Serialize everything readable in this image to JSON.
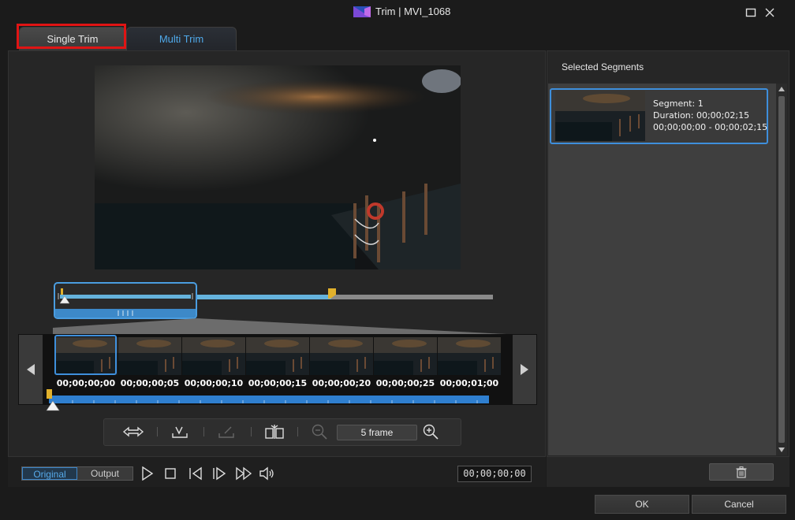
{
  "window": {
    "title": "Trim | MVI_1068",
    "maximize_icon": "maximize-icon",
    "close_icon": "close-icon"
  },
  "tabs": [
    {
      "label": "Single Trim",
      "active": true
    },
    {
      "label": "Multi Trim",
      "active": false
    }
  ],
  "filmstrip": {
    "timecodes": [
      "00;00;00;00",
      "00;00;00;05",
      "00;00;00;10",
      "00;00;00;15",
      "00;00;00;20",
      "00;00;00;25",
      "00;00;01;00"
    ],
    "prev_icon": "triangle-left-icon",
    "next_icon": "triangle-right-icon"
  },
  "toolbar": {
    "zoom_value": "5 frame",
    "icons": [
      "fit-icon",
      "mark-in-icon",
      "mark-out-icon",
      "split-icon",
      "zoom-out-icon",
      "zoom-in-icon"
    ]
  },
  "playback": {
    "original_label": "Original",
    "output_label": "Output",
    "timecode": "00;00;00;00"
  },
  "segments": {
    "title": "Selected Segments",
    "items": [
      {
        "segment": "Segment: 1",
        "duration": "Duration: 00;00;02;15",
        "range": "00;00;00;00 - 00;00;02;15"
      }
    ],
    "delete_icon": "trash-icon"
  },
  "footer": {
    "ok_label": "OK",
    "cancel_label": "Cancel"
  },
  "colors": {
    "accent": "#3e8fdc",
    "tab_active_text": "#4fa9ea",
    "highlight": "#e01414",
    "marker": "#e1b12c"
  }
}
